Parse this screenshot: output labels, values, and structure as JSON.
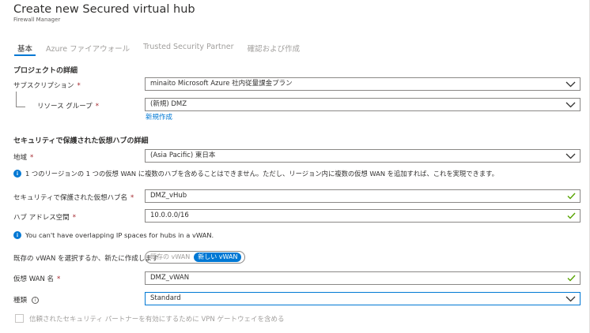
{
  "header": {
    "title": "Create new Secured virtual hub",
    "subtitle": "Firewall Manager"
  },
  "tabs": [
    {
      "label": "基本",
      "active": true
    },
    {
      "label": "Azure ファイアウォール",
      "active": false
    },
    {
      "label": "Trusted Security Partner",
      "active": false
    },
    {
      "label": "確認および作成",
      "active": false
    }
  ],
  "project": {
    "heading": "プロジェクトの詳細",
    "subscription_label": "サブスクリプション",
    "subscription_value": "minaito Microsoft Azure 社内従量課金プラン",
    "resource_group_label": "リソース グループ",
    "resource_group_value": "(新規) DMZ",
    "create_new_link": "新規作成"
  },
  "hub": {
    "heading": "セキュリティで保護された仮想ハブの詳細",
    "region_label": "地域",
    "region_value": "(Asia Pacific) 東日本",
    "region_info": "1 つのリージョンの 1 つの仮想 WAN に複数のハブを含めることはできません。ただし、リージョン内に複数の仮想 WAN を追加すれば、これを実現できます。",
    "hub_name_label": "セキュリティで保護された仮想ハブ名",
    "hub_name_value": "DMZ_vHub",
    "address_label": "ハブ アドレス空間",
    "address_value": "10.0.0.0/16",
    "overlap_info": "You can't have overlapping IP spaces for hubs in a vWAN.",
    "vwan_choice_label": "既存の vWAN を選択するか、新たに作成します",
    "vwan_toggle": {
      "existing": "既存の vWAN",
      "new": "新しい vWAN",
      "selected": "new"
    },
    "vwan_name_label": "仮想 WAN 名",
    "vwan_name_value": "DMZ_vWAN",
    "type_label": "種類",
    "type_value": "Standard",
    "vpn_checkbox_label": "信頼されたセキュリティ パートナーを有効にするために VPN ゲートウェイを含める",
    "vpn_checkbox_checked": false
  },
  "required_marker": "*",
  "colors": {
    "accent": "#0078d4",
    "success": "#57a300",
    "required": "#a4262c"
  }
}
